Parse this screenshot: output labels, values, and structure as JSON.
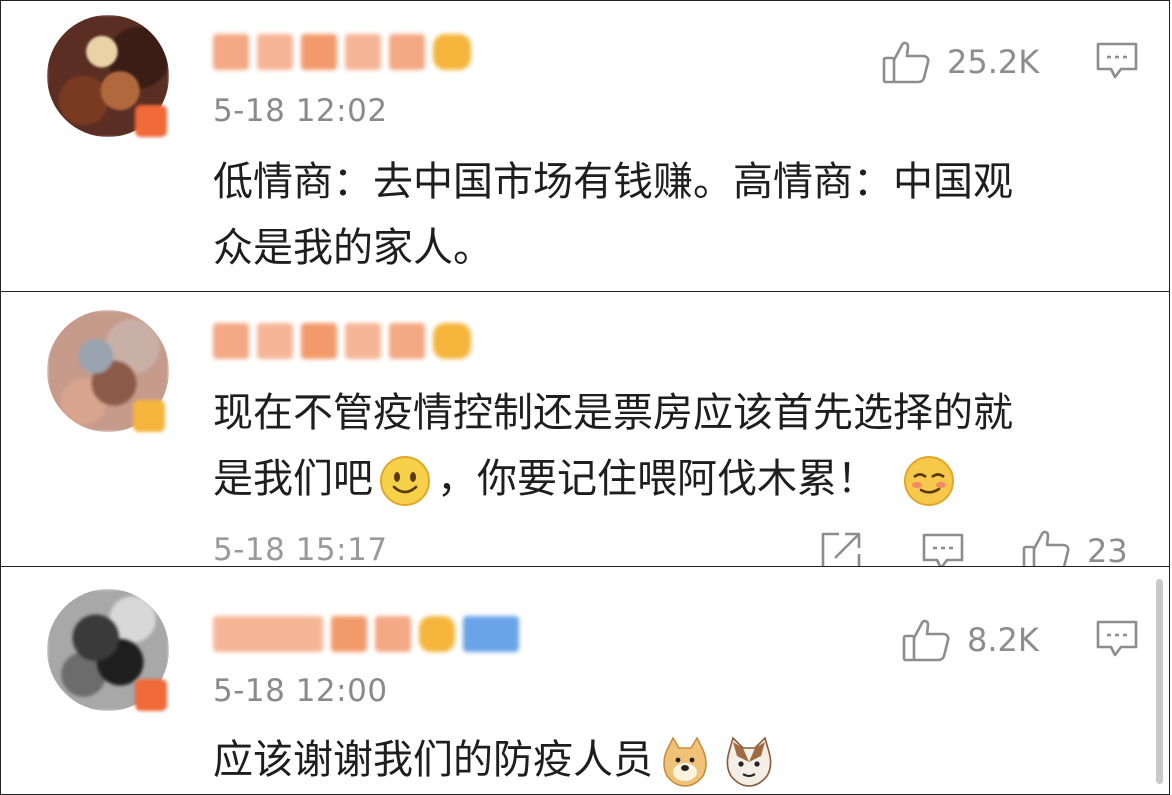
{
  "comments": [
    {
      "id": "c1",
      "time": "5-18 12:02",
      "text_line1": "低情商：去中国市场有钱赚。高情商：中国观",
      "text_line2": "众是我的家人。",
      "likes": "25.2K",
      "icons": {
        "like": "thumbs-up-icon",
        "comment": "comment-bubble-icon"
      }
    },
    {
      "id": "c2",
      "time": "5-18 15:17",
      "text_line1": "现在不管疫情控制还是票房应该首先选择的就",
      "text_line2_a": "是我们吧",
      "text_line2_b": "，你要记住喂阿伐木累！",
      "likes": "23",
      "icons": {
        "share": "share-icon",
        "comment": "comment-bubble-icon",
        "like": "thumbs-up-icon",
        "emoji1": "smile-emoji-icon",
        "emoji2": "smirk-emoji-icon"
      }
    },
    {
      "id": "c3",
      "time": "5-18 12:00",
      "text_line1": "应该谢谢我们的防疫人员",
      "likes": "8.2K",
      "icons": {
        "like": "thumbs-up-icon",
        "comment": "comment-bubble-icon",
        "emoji1": "doge-emoji-icon",
        "emoji2": "cat-emoji-icon"
      }
    }
  ],
  "colors": {
    "meta_gray": "#8a8a8a",
    "name_orange": "#f29a6b",
    "badge_orange": "#f06a3a",
    "crown_yellow": "#f5b53c",
    "badge_blue": "#6aa4e8"
  }
}
